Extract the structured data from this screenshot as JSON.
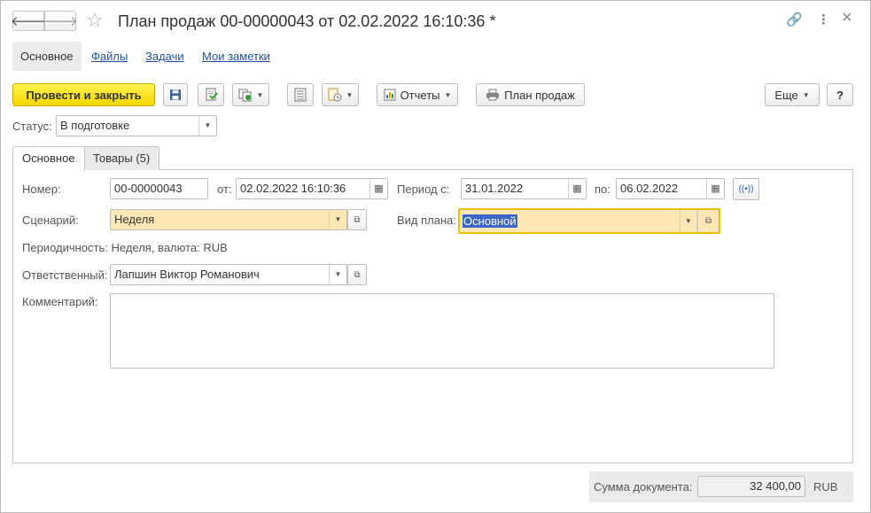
{
  "window": {
    "title": "План продаж 00-00000043 от 02.02.2022 16:10:36 *",
    "back_glyph": "🡐",
    "forward_glyph": "🡒",
    "star_glyph": "☆",
    "link_glyph": "🔗",
    "more_glyph": "⋮",
    "close_glyph": "×"
  },
  "top_tabs": [
    {
      "label": "Основное"
    },
    {
      "label": "Файлы"
    },
    {
      "label": "Задачи"
    },
    {
      "label": "Мои заметки"
    }
  ],
  "toolbar": {
    "post_close_label": "Провести и закрыть",
    "reports_label": "Отчеты",
    "sales_plan_label": "План продаж",
    "more_label": "Еще",
    "help_label": "?"
  },
  "status": {
    "label": "Статус:",
    "value": "В подготовке"
  },
  "inner_tabs": [
    {
      "label": "Основное"
    },
    {
      "label": "Товары (5)"
    }
  ],
  "form": {
    "number_label": "Номер:",
    "number_value": "00-00000043",
    "from_label": "от:",
    "date_value": "02.02.2022 16:10:36",
    "period_from_label": "Период с:",
    "period_from_value": "31.01.2022",
    "period_to_label": "по:",
    "period_to_value": "06.02.2022",
    "scenario_label": "Сценарий:",
    "scenario_value": "Неделя",
    "plan_type_label": "Вид плана:",
    "plan_type_value": "Основной",
    "periodicity_text": "Периодичность: Неделя, валюта: RUB",
    "responsible_label": "Ответственный:",
    "responsible_value": "Лапшин Виктор Романович",
    "comment_label": "Комментарий:",
    "comment_value": ""
  },
  "footer": {
    "sum_label": "Сумма документа:",
    "sum_value": "32 400,00",
    "currency": "RUB"
  },
  "colors": {
    "primary_button": "#f3d500",
    "filled_field": "#fde8b5",
    "link": "#1d52a4",
    "selection": "#3b66c8"
  }
}
